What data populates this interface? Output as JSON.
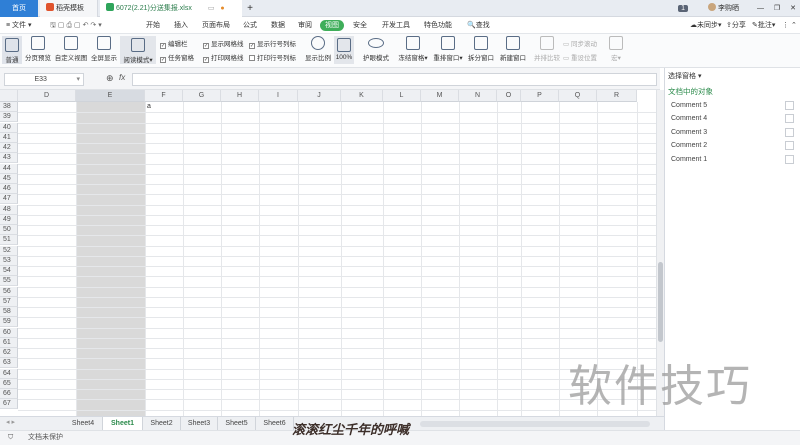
{
  "tabs": {
    "home": "首页",
    "template": "稻壳模板",
    "file": "6072(2.21)分送集报.xlsx",
    "new_tab": "+"
  },
  "user": {
    "badge": "1",
    "name": "李购晒"
  },
  "menu": {
    "file": "文件",
    "items": [
      "开始",
      "插入",
      "页面布局",
      "公式",
      "数据",
      "审阅",
      "视图",
      "安全",
      "开发工具",
      "特色功能"
    ],
    "active": "视图",
    "search": "查找",
    "sync": "未同步",
    "share": "分享",
    "comment": "批注"
  },
  "ribbon": {
    "buttons": [
      "普通",
      "分页预览",
      "自定义视图",
      "全屏显示",
      "阅读模式",
      "显示比例",
      "100%",
      "护眼模式",
      "冻结窗格",
      "重排窗口",
      "拆分窗口",
      "新建窗口",
      "并排比较",
      "同步滚动",
      "重设位置",
      "宏"
    ],
    "checks": [
      {
        "label": "编辑栏",
        "checked": true
      },
      {
        "label": "任务窗格",
        "checked": true
      },
      {
        "label": "显示网格线",
        "checked": true
      },
      {
        "label": "打印网格线",
        "checked": true
      },
      {
        "label": "显示行号列标",
        "checked": true
      },
      {
        "label": "打印行号列标",
        "checked": false
      }
    ]
  },
  "formula": {
    "cell": "E33",
    "fx": "fx",
    "value": ""
  },
  "grid": {
    "columns": [
      "D",
      "E",
      "F",
      "G",
      "H",
      "I",
      "J",
      "K",
      "L",
      "M",
      "N",
      "O",
      "P",
      "Q",
      "R"
    ],
    "rows": [
      "38",
      "39",
      "40",
      "41",
      "42",
      "43",
      "44",
      "45",
      "46",
      "47",
      "48",
      "49",
      "50",
      "51",
      "52",
      "53",
      "54",
      "55",
      "56",
      "57",
      "58",
      "59",
      "60",
      "61",
      "62",
      "63",
      "64",
      "65",
      "66",
      "67"
    ],
    "cell_f38": "a"
  },
  "sheets": [
    "Sheet4",
    "Sheet1",
    "Sheet2",
    "Sheet3",
    "Sheet5",
    "Sheet6"
  ],
  "active_sheet": "Sheet1",
  "status": "文档未保护",
  "pane": {
    "title": "选择窗格",
    "subtitle": "文档中的对象",
    "items": [
      "Comment 5",
      "Comment 4",
      "Comment 3",
      "Comment 2",
      "Comment 1"
    ]
  },
  "watermark": "软件技巧",
  "caption": "滚滚红尘千年的呼喊"
}
